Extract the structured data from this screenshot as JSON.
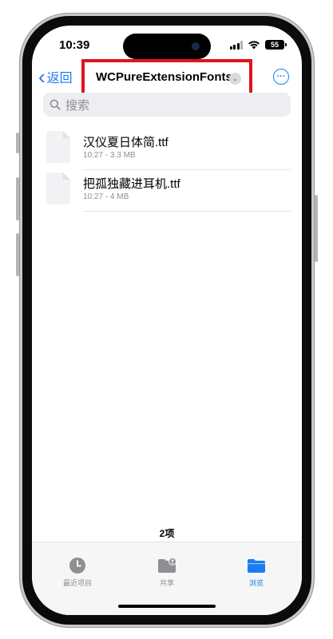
{
  "status_bar": {
    "time": "10:39",
    "battery": "55"
  },
  "nav": {
    "back_label": "返回",
    "title": "WCPureExtensionFonts",
    "title_dropdown_icon": "chevron-down-icon",
    "more_icon": "ellipsis-circle-icon"
  },
  "search": {
    "placeholder": "搜索"
  },
  "files": [
    {
      "name": "汉仪夏日体简.ttf",
      "meta": "10:27 - 3.3 MB"
    },
    {
      "name": "把孤独藏进耳机.ttf",
      "meta": "10:27 - 4 MB"
    }
  ],
  "item_count": "2项",
  "tabs": [
    {
      "label": "最近项目",
      "icon": "clock-icon",
      "active": false
    },
    {
      "label": "共享",
      "icon": "shared-folder-icon",
      "active": false
    },
    {
      "label": "浏览",
      "icon": "folder-icon",
      "active": true
    }
  ],
  "colors": {
    "accent": "#1a7cf2",
    "highlight_border": "#e0141b",
    "inactive_tab": "#8e8e93"
  }
}
